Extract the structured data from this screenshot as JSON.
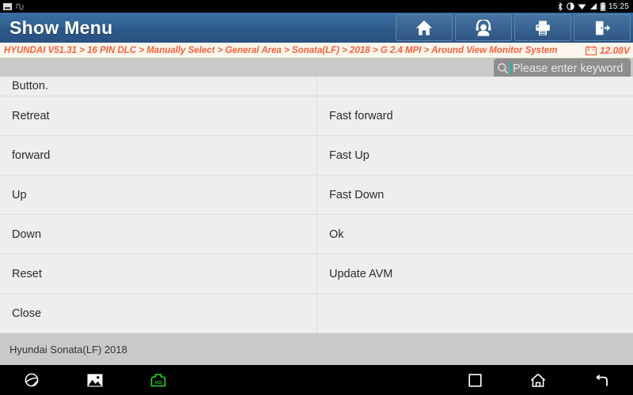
{
  "statusbar": {
    "left_icons": [
      "screenshot-icon",
      "usb-debug-icon"
    ],
    "right_icons": [
      "bluetooth-icon",
      "do-not-disturb-icon",
      "wifi-icon",
      "signal-icon",
      "battery-icon"
    ],
    "clock": "15:25"
  },
  "titlebar": {
    "title": "Show Menu",
    "buttons": [
      {
        "name": "home-button",
        "icon": "home-icon"
      },
      {
        "name": "support-button",
        "icon": "headset-person-icon"
      },
      {
        "name": "print-button",
        "icon": "printer-icon"
      },
      {
        "name": "exit-button",
        "icon": "exit-door-icon"
      }
    ]
  },
  "breadcrumb": {
    "path": "HYUNDAI V51.31 > 16 PIN DLC > Manually Select > General Area > Sonata(LF) > 2018 > G 2.4 MPI > Around View Monitor System",
    "battery_icon": "car-battery-icon",
    "voltage": "12.08V"
  },
  "search": {
    "icon": "search-icon",
    "placeholder": "Please enter keyword",
    "value": ""
  },
  "table": {
    "rows": [
      {
        "left": "Button.",
        "right": "",
        "clipped": true
      },
      {
        "left": "Retreat",
        "right": "Fast forward",
        "clipped": false
      },
      {
        "left": "forward",
        "right": "Fast Up",
        "clipped": false
      },
      {
        "left": "Up",
        "right": "Fast Down",
        "clipped": false
      },
      {
        "left": "Down",
        "right": "Ok",
        "clipped": false
      },
      {
        "left": "Reset",
        "right": "Update AVM",
        "clipped": false
      },
      {
        "left": "Close",
        "right": "",
        "clipped": false
      }
    ]
  },
  "footer": {
    "vehicle": "Hyundai Sonata(LF) 2018"
  },
  "navbar": {
    "left_buttons": [
      {
        "name": "browser-button",
        "icon": "globe-icon"
      },
      {
        "name": "gallery-button",
        "icon": "photo-icon"
      },
      {
        "name": "vci-button",
        "icon": "vci-connector-icon",
        "color": "#22dd22"
      }
    ],
    "right_buttons": [
      {
        "name": "recents-button",
        "icon": "square-icon"
      },
      {
        "name": "home-nav-button",
        "icon": "home-outline-icon"
      },
      {
        "name": "back-button",
        "icon": "back-arrow-icon"
      }
    ]
  },
  "colors": {
    "header_blue": "#31608f",
    "breadcrumb_orange": "#f4603c",
    "page_gray": "#c9c9c9",
    "row_gray": "#eeeeee",
    "vci_green": "#22dd22"
  }
}
